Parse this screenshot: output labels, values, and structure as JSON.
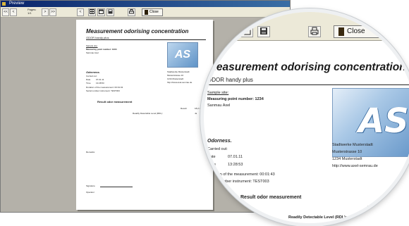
{
  "edge_text": [
    ".",
    "n",
    ")"
  ],
  "window": {
    "title": "Preview",
    "toolbar": {
      "pages_label": "Pages:",
      "pages_value": "1/1",
      "prev_symbol": "<",
      "next_symbol": ">",
      "first_symbol": "<<",
      "last_symbol": ">>",
      "close_label": "Close"
    }
  },
  "document": {
    "title": "Measurement odorising concentration",
    "subtitle": "ODOR handy plus",
    "sample_site": {
      "heading": "Sample site:",
      "measuring_point": "Measuring point number: 1234",
      "name": "Sanmau Axel"
    },
    "odorness": {
      "heading": "Odorness.",
      "carried_out": "Carried out:",
      "date_label": "Date",
      "date_value": "07.01.11",
      "time_label": "Time",
      "time_value": "13:28:53",
      "duration": "Duration of the measurement: 00:01:43",
      "serial": "Serial number instrument:  TEST003"
    },
    "company": {
      "name": "Stadtwerke Musterstadt",
      "street": "Musterstrasse 10",
      "city": "1234 Musterstadt",
      "url": "http://www.axel-semrau.de"
    },
    "result": {
      "heading": "Result odor measurement",
      "result_label": "Result:",
      "result_value": "18,2 mg/",
      "rdl_label": "Readily Detectable Level (RDL):",
      "rdl_value": "Ja"
    },
    "remarks_label": "Remarks:",
    "signature_label": "Signature",
    "operator_label": "Operator",
    "logo_text": "AS"
  }
}
